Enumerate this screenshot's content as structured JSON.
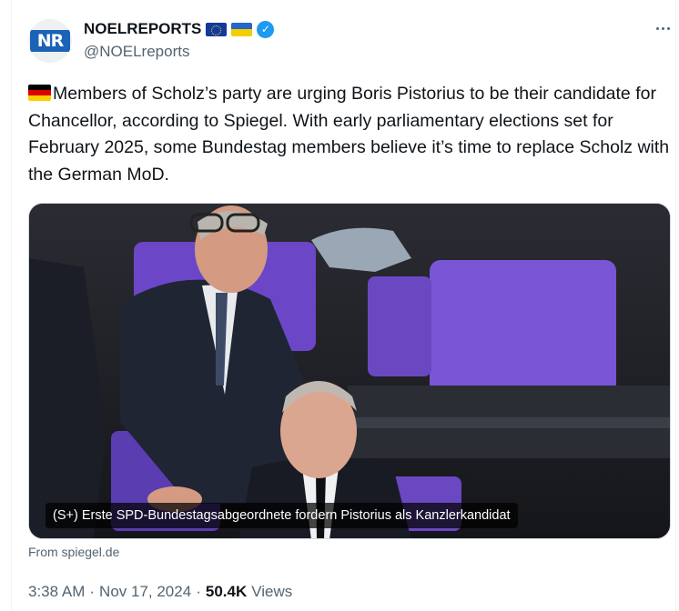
{
  "author": {
    "avatar_text": "NR",
    "display_name": "NOELREPORTS",
    "handle": "@NOELreports",
    "badges": [
      "eu-flag",
      "ukraine-flag",
      "verified-badge"
    ]
  },
  "tweet": {
    "flag": "germany-flag",
    "text": "Members of Scholz’s party are urging Boris Pistorius to be their candidate for Chancellor, according to Spiegel. With early parliamentary elections set for February 2025, some Bundestag members believe it’s time to replace Scholz with the German MoD."
  },
  "card": {
    "caption": "(S+) Erste SPD-Bundestagsabgeordnete fordern Pistorius als Kanzlerkandidat",
    "source": "From spiegel.de"
  },
  "meta": {
    "time": "3:38 AM",
    "separator": "·",
    "date": "Nov 17, 2024",
    "views_count": "50.4K",
    "views_label": "Views"
  },
  "colors": {
    "text": "#0f1419",
    "muted": "#536471",
    "verified": "#1d9bf0",
    "seat_purple": "#7a55d6"
  }
}
